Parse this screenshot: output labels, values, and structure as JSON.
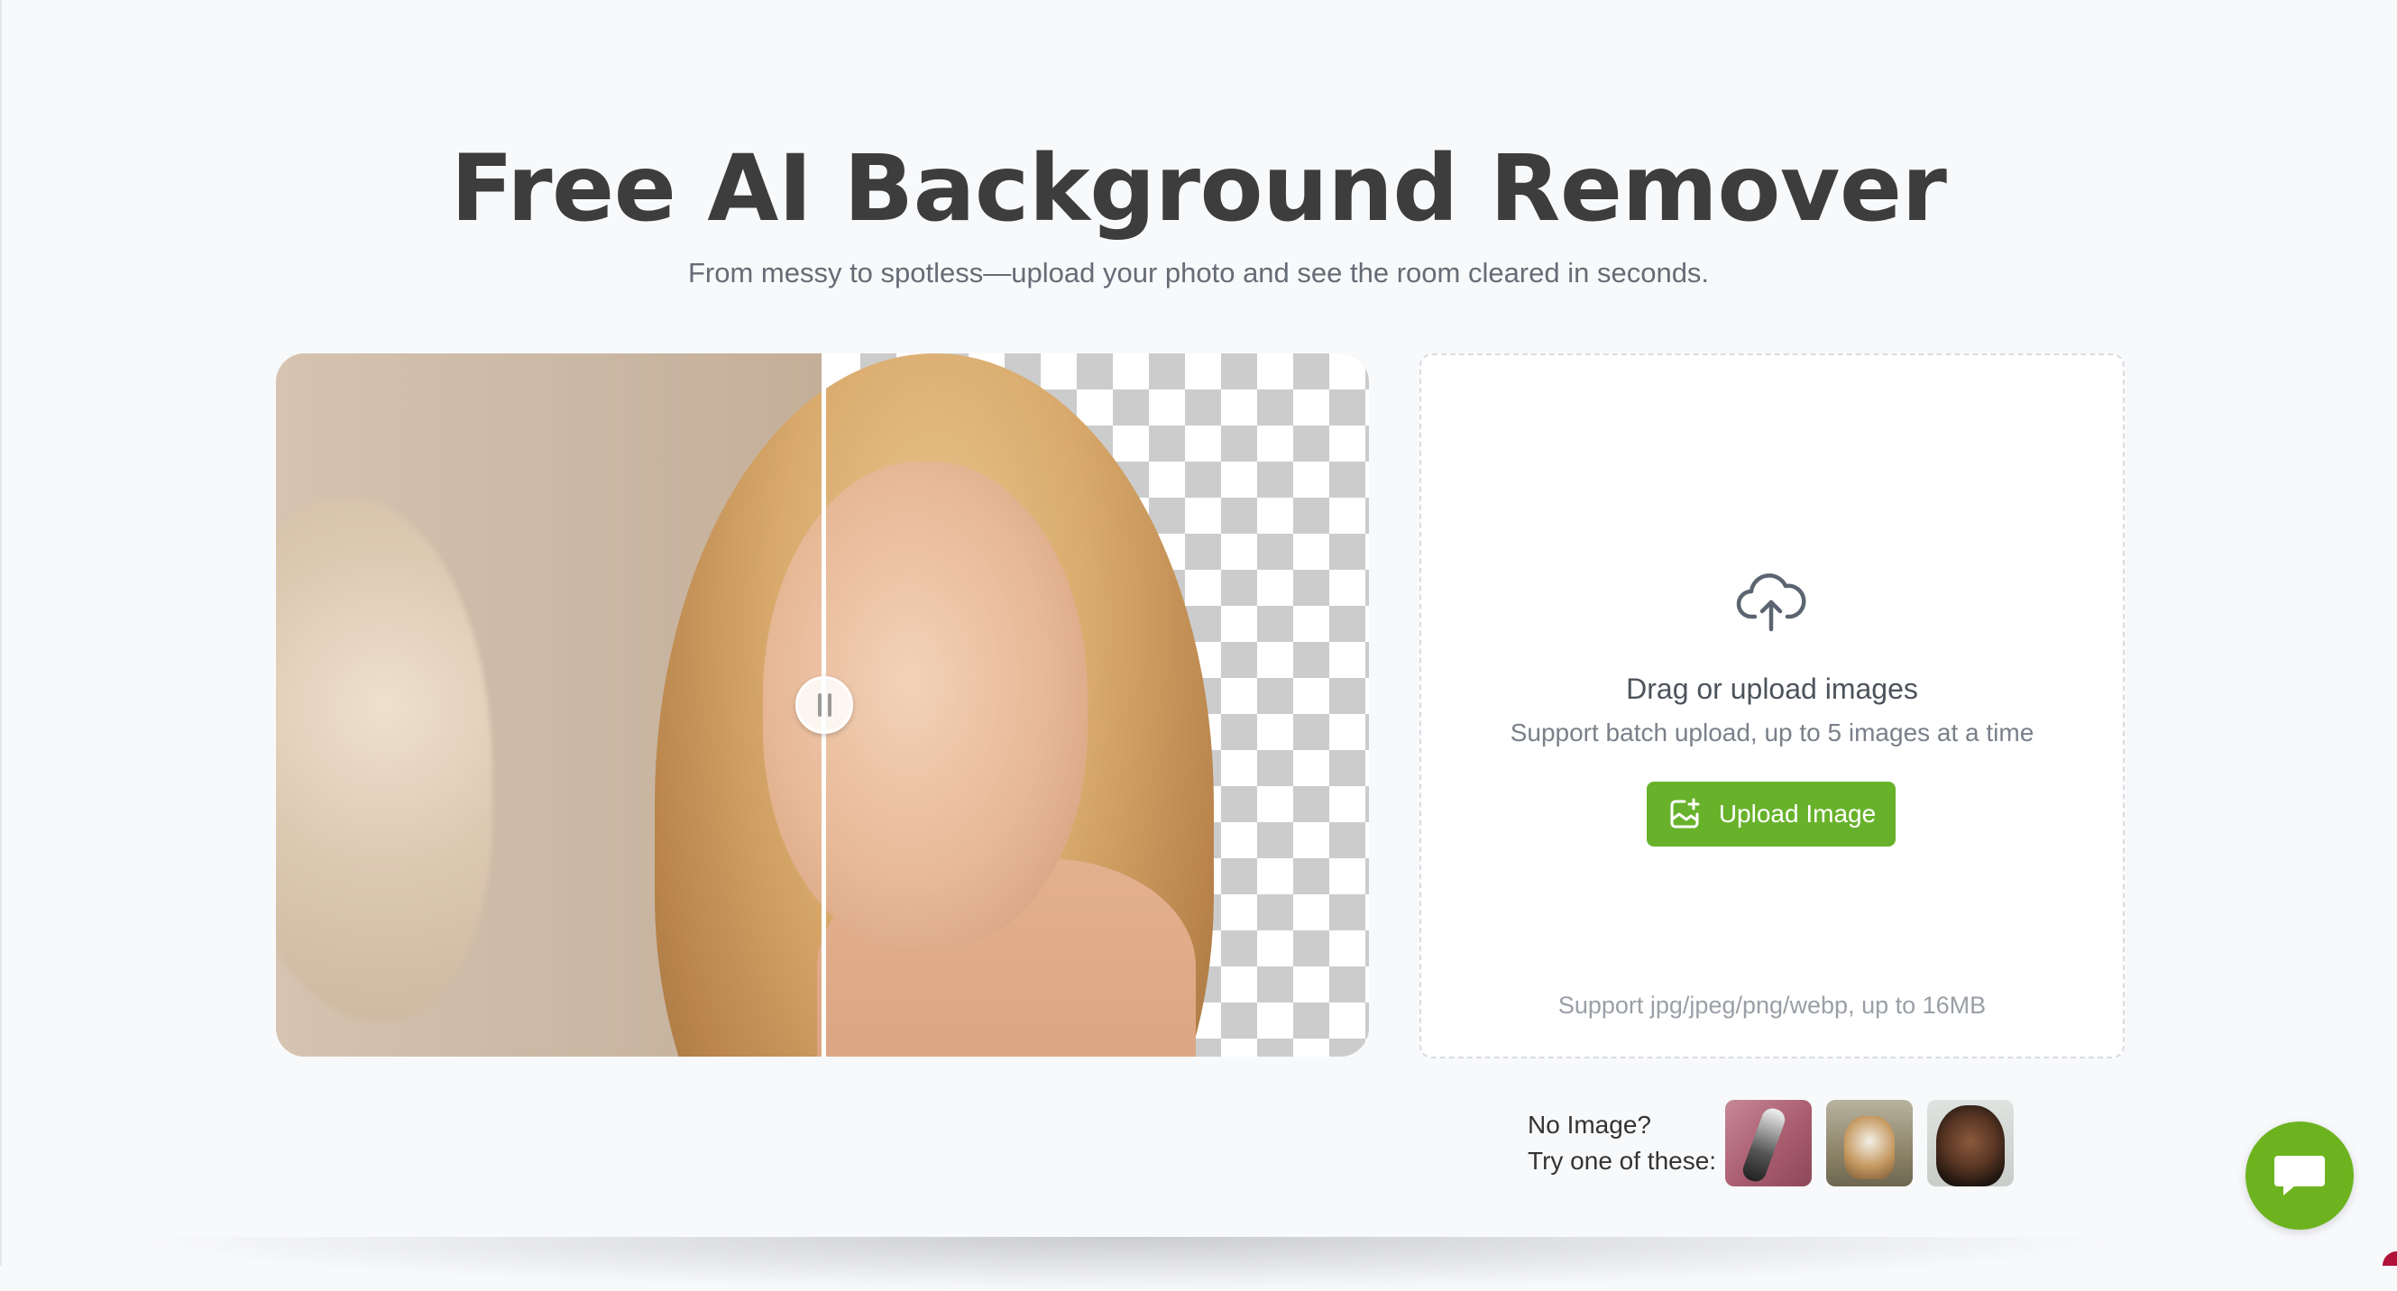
{
  "header": {
    "title": "Free AI Background Remover",
    "subtitle": "From messy to spotless—upload your photo and see the room cleared in seconds."
  },
  "comparison": {
    "divider_position_pct": 50
  },
  "upload": {
    "icon": "cloud-upload-icon",
    "drag_text": "Drag or upload images",
    "batch_text": "Support batch upload, up to 5 images at a time",
    "button_label": "Upload Image",
    "format_text": "Support jpg/jpeg/png/webp, up to 16MB"
  },
  "samples": {
    "line1": "No Image?",
    "line2": "Try one of these:"
  },
  "colors": {
    "accent": "#68b22b",
    "chat": "#6db31f",
    "background": "#f8f9fb"
  }
}
